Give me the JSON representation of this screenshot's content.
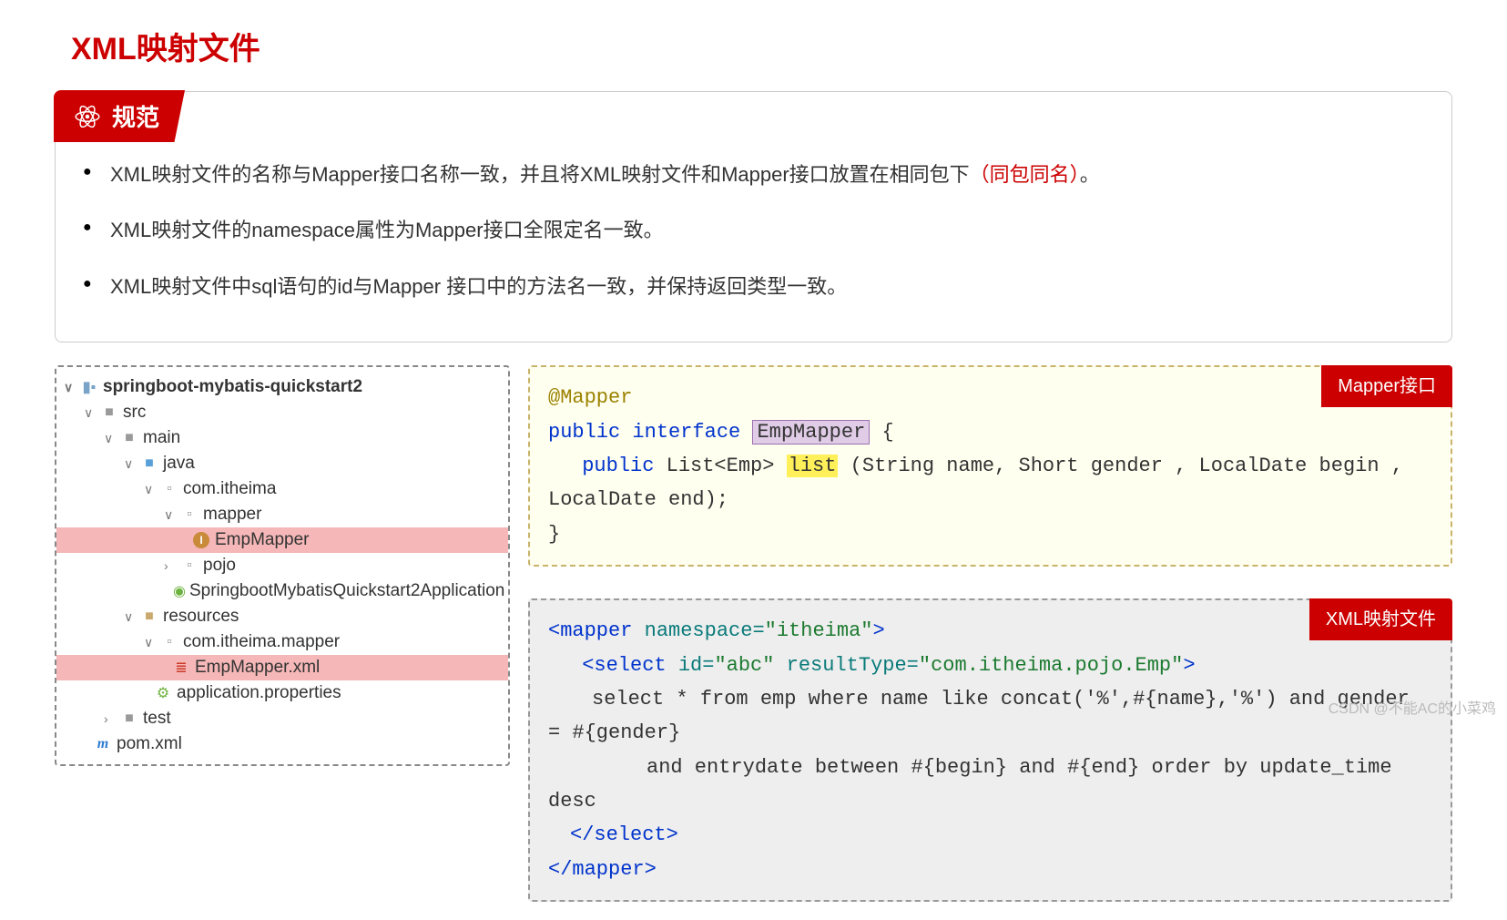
{
  "title": "XML映射文件",
  "rules": {
    "tab_label": "规范",
    "items": [
      {
        "pre": "XML映射文件的名称与Mapper接口名称一致，并且将XML映射文件和Mapper接口放置在相同包下",
        "red": "（同包同名）",
        "post": "。"
      },
      {
        "pre": "XML映射文件的namespace属性为Mapper接口全限定名一致。",
        "red": "",
        "post": ""
      },
      {
        "pre": "XML映射文件中sql语句的id与Mapper 接口中的方法名一致，并保持返回类型一致。",
        "red": "",
        "post": ""
      }
    ]
  },
  "tree": {
    "project": "springboot-mybatis-quickstart2",
    "nodes": {
      "src": "src",
      "main": "main",
      "java": "java",
      "pkg_java": "com.itheima",
      "mapper_pkg": "mapper",
      "emp_mapper": "EmpMapper",
      "pojo": "pojo",
      "app_class": "SpringbootMybatisQuickstart2Application",
      "resources": "resources",
      "pkg_res": "com.itheima.mapper",
      "emp_mapper_xml": "EmpMapper.xml",
      "app_props": "application.properties",
      "test": "test",
      "pom": "pom.xml"
    }
  },
  "code1": {
    "badge": "Mapper接口",
    "l1_ann": "@Mapper",
    "l2_kw1": "public",
    "l2_kw2": "interface",
    "l2_name": "EmpMapper",
    "l2_brace": "{",
    "l3_kw": "public",
    "l3_type": "List<Emp>",
    "l3_method": "list",
    "l3_params": "(String name, Short gender , LocalDate begin , LocalDate end);",
    "l4": "}"
  },
  "code2": {
    "badge": "XML映射文件",
    "mapper_open1": "<mapper",
    "mapper_attr": "namespace=",
    "mapper_val": "\"itheima\"",
    "mapper_open2": ">",
    "select_open1": "<select",
    "select_id": "id=",
    "select_id_val": "\"abc\"",
    "select_rt": "resultType=",
    "select_rt_val": "\"com.itheima.pojo.Emp\"",
    "select_open2": ">",
    "sql_l1": "select * from emp where name like concat('%',#{name},'%') and gender = #{gender}",
    "sql_l2": "and entrydate between #{begin} and #{end} order by update_time desc",
    "select_close": "</select>",
    "mapper_close": "</mapper>"
  },
  "watermark": "CSDN @不能AC的小菜鸡"
}
